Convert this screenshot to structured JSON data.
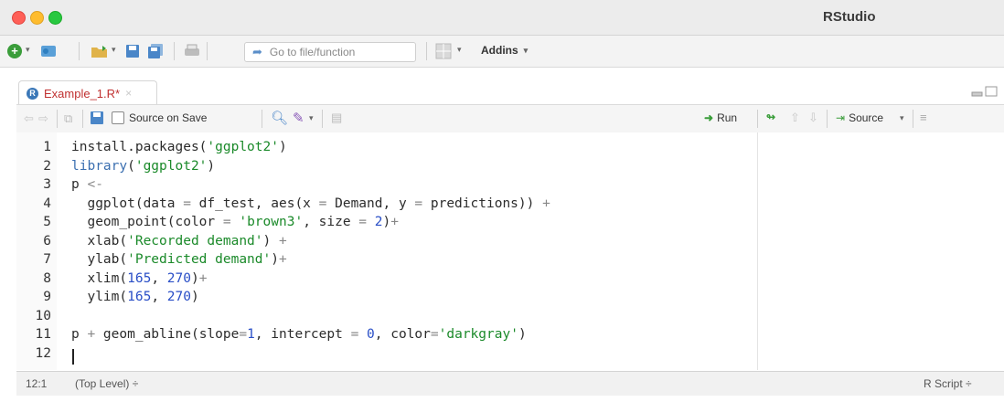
{
  "window": {
    "title": "RStudio"
  },
  "toolbar": {
    "goto_placeholder": "Go to file/function",
    "addins_label": "Addins"
  },
  "tab": {
    "name": "Example_1.R*",
    "close": "×"
  },
  "editor_toolbar": {
    "source_on_save": "Source on Save",
    "run": "Run",
    "source": "Source"
  },
  "code": {
    "lines": [
      {
        "n": "1",
        "tokens": [
          {
            "t": "install.packages(",
            "c": "fn"
          },
          {
            "t": "'ggplot2'",
            "c": "str"
          },
          {
            "t": ")",
            "c": "fn"
          }
        ]
      },
      {
        "n": "2",
        "tokens": [
          {
            "t": "library",
            "c": "kw"
          },
          {
            "t": "(",
            "c": "fn"
          },
          {
            "t": "'ggplot2'",
            "c": "str"
          },
          {
            "t": ")",
            "c": "fn"
          }
        ]
      },
      {
        "n": "3",
        "tokens": [
          {
            "t": "p ",
            "c": "fn"
          },
          {
            "t": "<-",
            "c": "op"
          }
        ]
      },
      {
        "n": "4",
        "tokens": [
          {
            "t": "  ggplot(data ",
            "c": "fn"
          },
          {
            "t": "=",
            "c": "op"
          },
          {
            "t": " df_test, aes(x ",
            "c": "fn"
          },
          {
            "t": "=",
            "c": "op"
          },
          {
            "t": " Demand, y ",
            "c": "fn"
          },
          {
            "t": "=",
            "c": "op"
          },
          {
            "t": " predictions)) ",
            "c": "fn"
          },
          {
            "t": "+",
            "c": "op"
          }
        ]
      },
      {
        "n": "5",
        "tokens": [
          {
            "t": "  geom_point(color ",
            "c": "fn"
          },
          {
            "t": "=",
            "c": "op"
          },
          {
            "t": " ",
            "c": "fn"
          },
          {
            "t": "'brown3'",
            "c": "str"
          },
          {
            "t": ", size ",
            "c": "fn"
          },
          {
            "t": "=",
            "c": "op"
          },
          {
            "t": " ",
            "c": "fn"
          },
          {
            "t": "2",
            "c": "num"
          },
          {
            "t": ")",
            "c": "fn"
          },
          {
            "t": "+",
            "c": "op"
          }
        ]
      },
      {
        "n": "6",
        "tokens": [
          {
            "t": "  xlab(",
            "c": "fn"
          },
          {
            "t": "'Recorded demand'",
            "c": "str"
          },
          {
            "t": ") ",
            "c": "fn"
          },
          {
            "t": "+",
            "c": "op"
          }
        ]
      },
      {
        "n": "7",
        "tokens": [
          {
            "t": "  ylab(",
            "c": "fn"
          },
          {
            "t": "'Predicted demand'",
            "c": "str"
          },
          {
            "t": ")",
            "c": "fn"
          },
          {
            "t": "+",
            "c": "op"
          }
        ]
      },
      {
        "n": "8",
        "tokens": [
          {
            "t": "  xlim(",
            "c": "fn"
          },
          {
            "t": "165",
            "c": "num"
          },
          {
            "t": ", ",
            "c": "fn"
          },
          {
            "t": "270",
            "c": "num"
          },
          {
            "t": ")",
            "c": "fn"
          },
          {
            "t": "+",
            "c": "op"
          }
        ]
      },
      {
        "n": "9",
        "tokens": [
          {
            "t": "  ylim(",
            "c": "fn"
          },
          {
            "t": "165",
            "c": "num"
          },
          {
            "t": ", ",
            "c": "fn"
          },
          {
            "t": "270",
            "c": "num"
          },
          {
            "t": ")",
            "c": "fn"
          }
        ]
      },
      {
        "n": "10",
        "tokens": []
      },
      {
        "n": "11",
        "tokens": [
          {
            "t": "p ",
            "c": "fn"
          },
          {
            "t": "+",
            "c": "op"
          },
          {
            "t": " geom_abline(slope",
            "c": "fn"
          },
          {
            "t": "=",
            "c": "op"
          },
          {
            "t": "1",
            "c": "num"
          },
          {
            "t": ", intercept ",
            "c": "fn"
          },
          {
            "t": "=",
            "c": "op"
          },
          {
            "t": " ",
            "c": "fn"
          },
          {
            "t": "0",
            "c": "num"
          },
          {
            "t": ", color",
            "c": "fn"
          },
          {
            "t": "=",
            "c": "op"
          },
          {
            "t": "'darkgray'",
            "c": "str"
          },
          {
            "t": ")",
            "c": "fn"
          }
        ]
      },
      {
        "n": "12",
        "tokens": []
      }
    ]
  },
  "status": {
    "position": "12:1",
    "scope": "(Top Level) ÷",
    "filetype": "R Script ÷"
  }
}
